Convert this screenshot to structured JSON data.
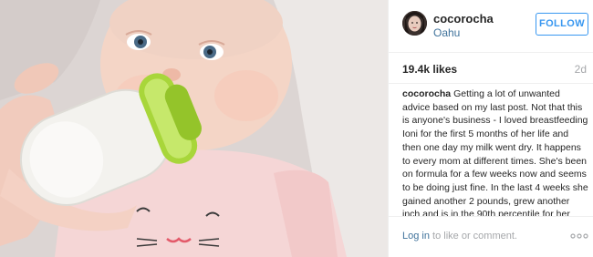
{
  "header": {
    "username": "cocorocha",
    "location": "Oahu",
    "follow_label": "FOLLOW"
  },
  "stats": {
    "likes": "19.4k likes",
    "age": "2d"
  },
  "caption": {
    "username": "cocorocha",
    "text": "Getting a lot of unwanted advice based on my last post. Not that this is anyone's business - I loved breastfeeding Ioni for the first 5 months of her life and then one day my milk went dry. It happens to every mom at different times. She's been on formula for a few weeks now and seems to be doing just fine. In the last 4 weeks she gained another 2 pounds, grew another inch and is in the 90th percentile for her"
  },
  "footer": {
    "login_link": "Log in",
    "login_rest": " to like or comment."
  },
  "icons": {
    "avatar": "avatar-photo",
    "more": "more-options-icon"
  },
  "colors": {
    "link_blue": "#3f729b",
    "follow_blue": "#3897f0",
    "muted": "#a5a7aa",
    "bottle_cap": "#a8d63a"
  }
}
